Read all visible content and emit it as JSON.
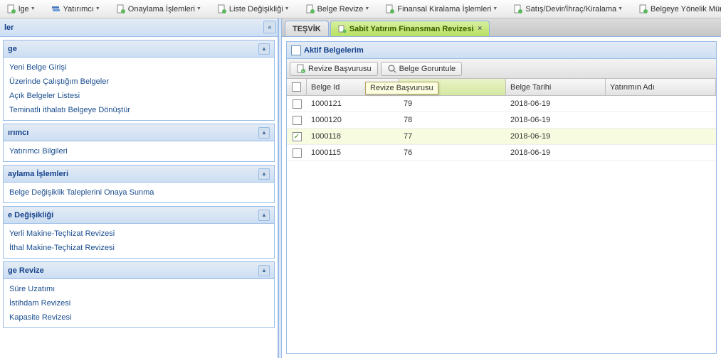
{
  "toolbar": {
    "items": [
      {
        "label": "lge",
        "icon": "doc-green"
      },
      {
        "label": "Yatırımcı",
        "icon": "stack"
      },
      {
        "label": "Onaylama İşlemleri",
        "icon": "doc-green"
      },
      {
        "label": "Liste Değişikliği",
        "icon": "doc-green"
      },
      {
        "label": "Belge Revize",
        "icon": "doc-green"
      },
      {
        "label": "Finansal Kiralama İşlemleri",
        "icon": "doc-green"
      },
      {
        "label": "Satış/Devir/İhraç/Kiralama",
        "icon": "doc-green"
      },
      {
        "label": "Belgeye Yönelik Münfer",
        "icon": "doc-green"
      }
    ]
  },
  "sidebar": {
    "header": "ler",
    "groups": [
      {
        "title": "ge",
        "items": [
          "Yeni Belge Girişi",
          "Üzerinde Çalıştığım Belgeler",
          "Açık Belgeler Listesi",
          "Teminatlı ithalatı Belgeye Dönüştür"
        ]
      },
      {
        "title": "ırımcı",
        "items": [
          "Yatırımcı Bilgileri"
        ]
      },
      {
        "title": "aylama İşlemleri",
        "items": [
          "Belge Değişiklik Taleplerini Onaya Sunma"
        ]
      },
      {
        "title": "e Değişikliği",
        "items": [
          "Yerli Makine-Teçhizat Revizesi",
          "İthal Makine-Teçhizat Revizesi"
        ]
      },
      {
        "title": "ge Revize",
        "items": [
          "Süre Uzatımı",
          "İstihdam Revizesi",
          "Kapasite Revizesi"
        ]
      }
    ]
  },
  "tabs": {
    "tab1": "TEŞVİK",
    "tab2": "Sabit Yatırım Finansman Revizesi"
  },
  "mainPanel": {
    "title": "Aktif Belgelerim",
    "actions": {
      "revize": "Revize Başvurusu",
      "goruntule": "Belge Goruntule"
    },
    "tooltip": "Revize Başvurusu",
    "columns": {
      "id": "Belge Id",
      "no": "",
      "date": "Belge Tarihi",
      "name": "Yatırımın Adı"
    },
    "rows": [
      {
        "checked": false,
        "id": "1000121",
        "no": "79",
        "date": "2018-06-19",
        "name": ""
      },
      {
        "checked": false,
        "id": "1000120",
        "no": "78",
        "date": "2018-06-19",
        "name": ""
      },
      {
        "checked": true,
        "id": "1000118",
        "no": "77",
        "date": "2018-06-19",
        "name": ""
      },
      {
        "checked": false,
        "id": "1000115",
        "no": "76",
        "date": "2018-06-19",
        "name": ""
      }
    ]
  }
}
